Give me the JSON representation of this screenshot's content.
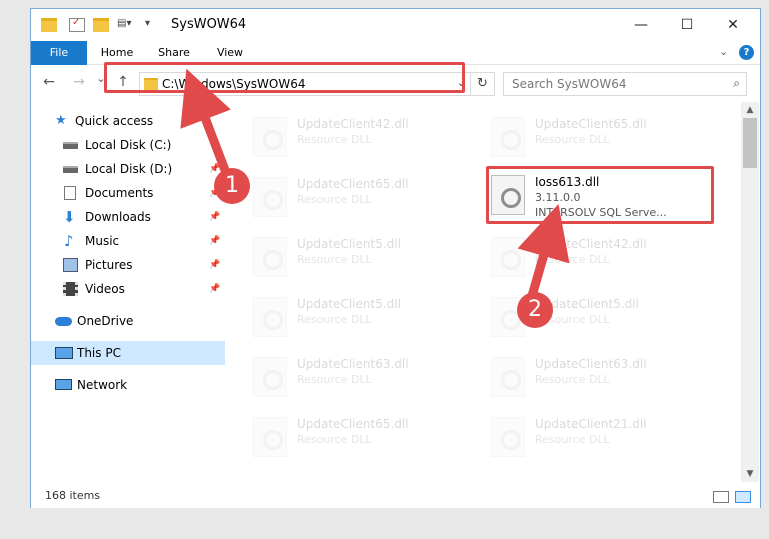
{
  "window": {
    "title": "SysWOW64",
    "controls": {
      "minimize": "—",
      "maximize": "☐",
      "close": "✕"
    }
  },
  "ribbon": {
    "tabs": [
      {
        "label": "File"
      },
      {
        "label": "Home"
      },
      {
        "label": "Share"
      },
      {
        "label": "View"
      }
    ],
    "help": "?"
  },
  "nav": {
    "back": "←",
    "forward": "→",
    "recent": "⌄",
    "up": "↑",
    "address": "C:\\Windows\\SysWOW64",
    "address_dropdown": "⌄",
    "refresh": "↻",
    "search_placeholder": "Search SysWOW64",
    "search_icon": "⌕"
  },
  "sidebar": {
    "items": [
      {
        "label": "Quick access",
        "icon": "star-icon",
        "pinned": false,
        "selected": false
      },
      {
        "label": "Local Disk (C:)",
        "icon": "disk-icon",
        "pinned": false,
        "selected": false
      },
      {
        "label": "Local Disk (D:)",
        "icon": "disk-icon",
        "pinned": true,
        "selected": false
      },
      {
        "label": "Documents",
        "icon": "document-icon",
        "pinned": true,
        "selected": false
      },
      {
        "label": "Downloads",
        "icon": "download-icon",
        "pinned": true,
        "selected": false
      },
      {
        "label": "Music",
        "icon": "music-icon",
        "pinned": true,
        "selected": false
      },
      {
        "label": "Pictures",
        "icon": "picture-icon",
        "pinned": true,
        "selected": false
      },
      {
        "label": "Videos",
        "icon": "video-icon",
        "pinned": true,
        "selected": false
      },
      {
        "label": "OneDrive",
        "icon": "cloud-icon",
        "pinned": false,
        "selected": false
      },
      {
        "label": "This PC",
        "icon": "computer-icon",
        "pinned": false,
        "selected": true
      },
      {
        "label": "Network",
        "icon": "network-icon",
        "pinned": false,
        "selected": false
      }
    ],
    "pin_glyph": "📌"
  },
  "files": {
    "left_column": [
      {
        "name": "UpdateClient42.dll",
        "type": "Resource DLL"
      },
      {
        "name": "UpdateClient65.dll",
        "type": "Resource DLL"
      },
      {
        "name": "UpdateClient5.dll",
        "type": "Resource DLL"
      },
      {
        "name": "UpdateClient5.dll",
        "type": "Resource DLL"
      },
      {
        "name": "UpdateClient63.dll",
        "type": "Resource DLL"
      },
      {
        "name": "UpdateClient65.dll",
        "type": "Resource DLL"
      }
    ],
    "right_column": [
      {
        "name": "UpdateClient65.dll",
        "type": "Resource DLL"
      },
      {
        "name": "UpdateClient42.dll",
        "type": "Resource DLL"
      },
      {
        "name": "UpdateClient5.dll",
        "type": "Resource DLL"
      },
      {
        "name": "UpdateClient63.dll",
        "type": "Resource DLL"
      },
      {
        "name": "UpdateClient21.dll",
        "type": "Resource DLL"
      }
    ],
    "featured": {
      "name": "Ioss613.dll",
      "version": "3.11.0.0",
      "description": "INTERSOLV SQL Serve..."
    }
  },
  "annotations": {
    "badge_1": "1",
    "badge_2": "2",
    "color": "#e04a4a"
  },
  "status": {
    "item_count": "168 items"
  },
  "scrollbar": {
    "up": "▲",
    "down": "▼"
  }
}
